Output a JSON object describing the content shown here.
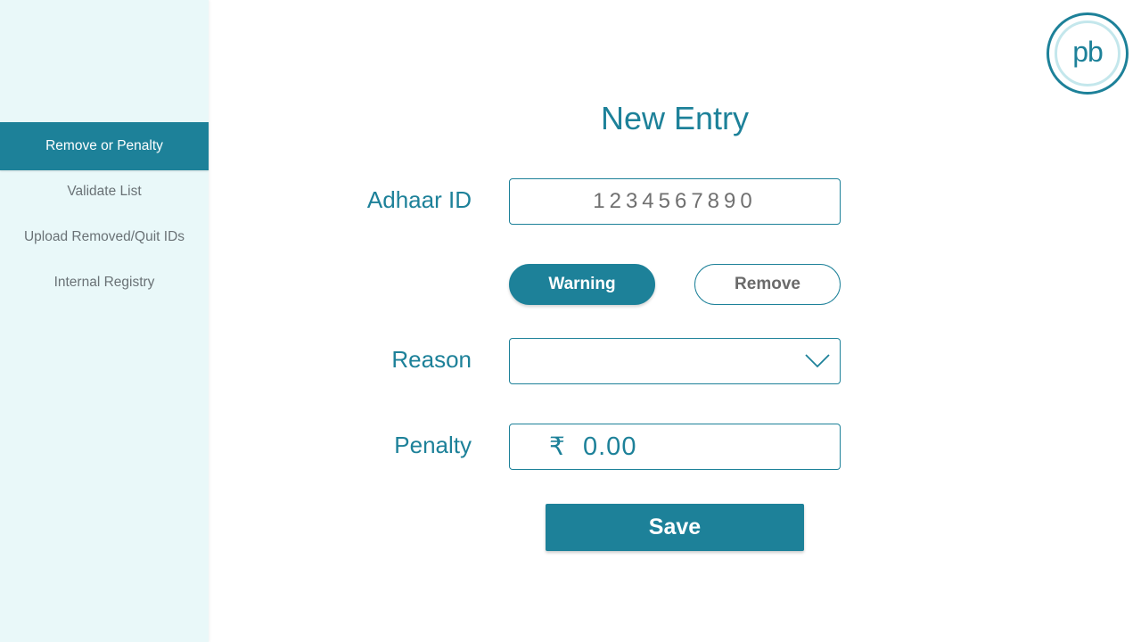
{
  "sidebar": {
    "items": [
      {
        "label": "Remove or Penalty",
        "active": true
      },
      {
        "label": "Validate List",
        "active": false
      },
      {
        "label": "Upload Removed/Quit IDs",
        "active": false
      },
      {
        "label": "Internal Registry",
        "active": false
      }
    ]
  },
  "logo": {
    "text": "pb",
    "icon": "pb-logo-icon"
  },
  "form": {
    "title": "New Entry",
    "adhaar": {
      "label": "Adhaar ID",
      "value": "1234567890"
    },
    "action_toggle": {
      "warning_label": "Warning",
      "remove_label": "Remove",
      "selected": "Warning"
    },
    "reason": {
      "label": "Reason",
      "value": "",
      "icon": "chevron-down-icon"
    },
    "penalty": {
      "label": "Penalty",
      "currency_symbol": "₹",
      "value": "0.00"
    },
    "save_label": "Save"
  },
  "colors": {
    "accent": "#1d8199",
    "sidebar_bg": "#e9f8f9",
    "logo_ring_light": "#c4e7ec",
    "muted_text": "#6a7276"
  }
}
